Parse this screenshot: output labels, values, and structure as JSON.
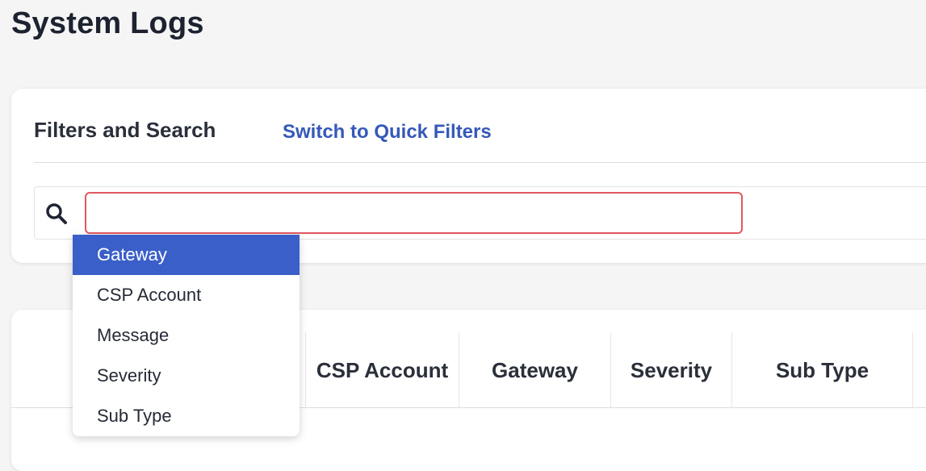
{
  "page": {
    "title": "System Logs"
  },
  "filters": {
    "title": "Filters and Search",
    "switch_link": "Switch to Quick Filters",
    "search": {
      "value": "",
      "placeholder": "",
      "icon": "search-icon"
    }
  },
  "dropdown": {
    "selected_index": 0,
    "options": [
      "Gateway",
      "CSP Account",
      "Message",
      "Severity",
      "Sub Type"
    ]
  },
  "table": {
    "columns": [
      "CSP Account",
      "Gateway",
      "Severity",
      "Sub Type"
    ]
  },
  "colors": {
    "accent": "#3b5fc9",
    "link": "#3559b8",
    "input_focus_border": "#e0585f",
    "background": "#f5f5f5"
  }
}
